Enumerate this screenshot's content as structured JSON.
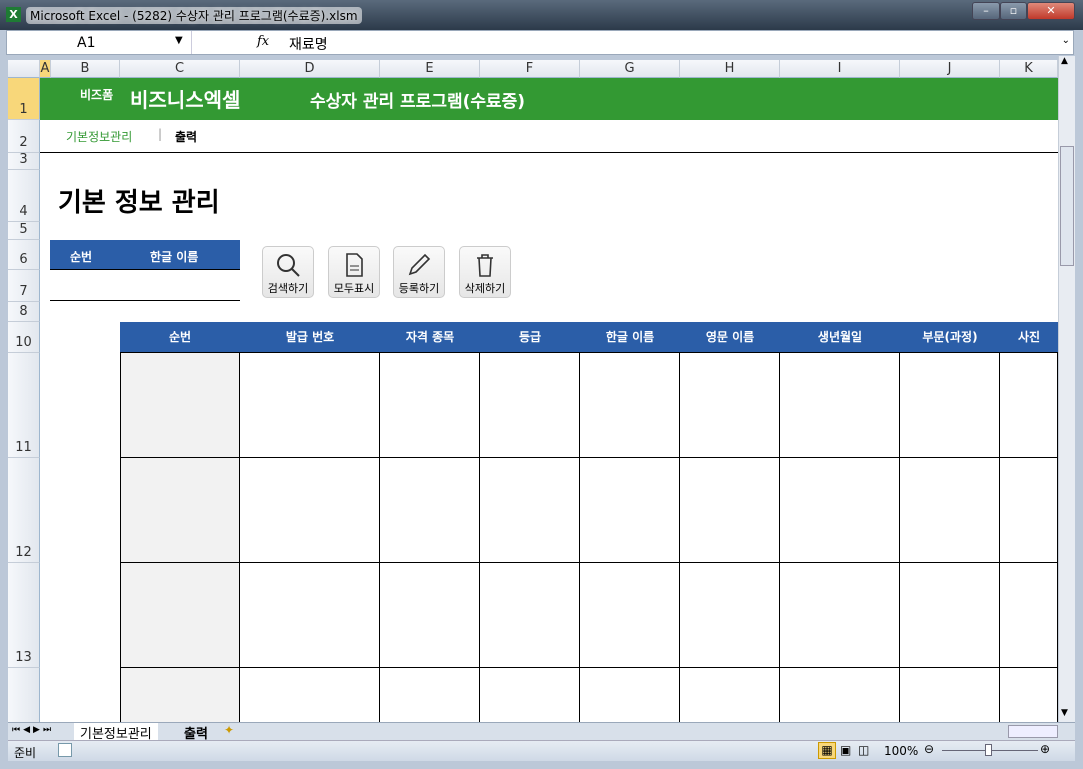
{
  "window": {
    "title": "Microsoft Excel - (5282) 수상자 관리 프로그램(수료증).xlsm"
  },
  "formula_bar": {
    "name_box": "A1",
    "fx": "fx",
    "value": "재료명"
  },
  "columns": [
    "A",
    "B",
    "C",
    "D",
    "E",
    "F",
    "G",
    "H",
    "I",
    "J",
    "K"
  ],
  "rows": [
    "1",
    "2",
    "3",
    "4",
    "5",
    "6",
    "7",
    "8",
    "10",
    "11",
    "12",
    "13"
  ],
  "banner": {
    "brand_small": "비즈폼",
    "brand": "비즈니스엑셀",
    "title": "수상자 관리 프로그램(수료증)"
  },
  "nav": {
    "active": "기본정보관리",
    "sep": "|",
    "other": "출력"
  },
  "page_title": "기본 정보 관리",
  "search": {
    "col1": "순번",
    "col2": "한글 이름"
  },
  "buttons": {
    "search": "검색하기",
    "show_all": "모두표시",
    "register": "등록하기",
    "delete": "삭제하기"
  },
  "table": {
    "headers": [
      "순번",
      "발급 번호",
      "자격 종목",
      "등급",
      "한글 이름",
      "영문 이름",
      "생년월일",
      "부문(과정)",
      "사진"
    ]
  },
  "sheet_tabs": [
    "기본정보관리",
    "출력"
  ],
  "status": {
    "ready": "준비",
    "zoom": "100%"
  }
}
